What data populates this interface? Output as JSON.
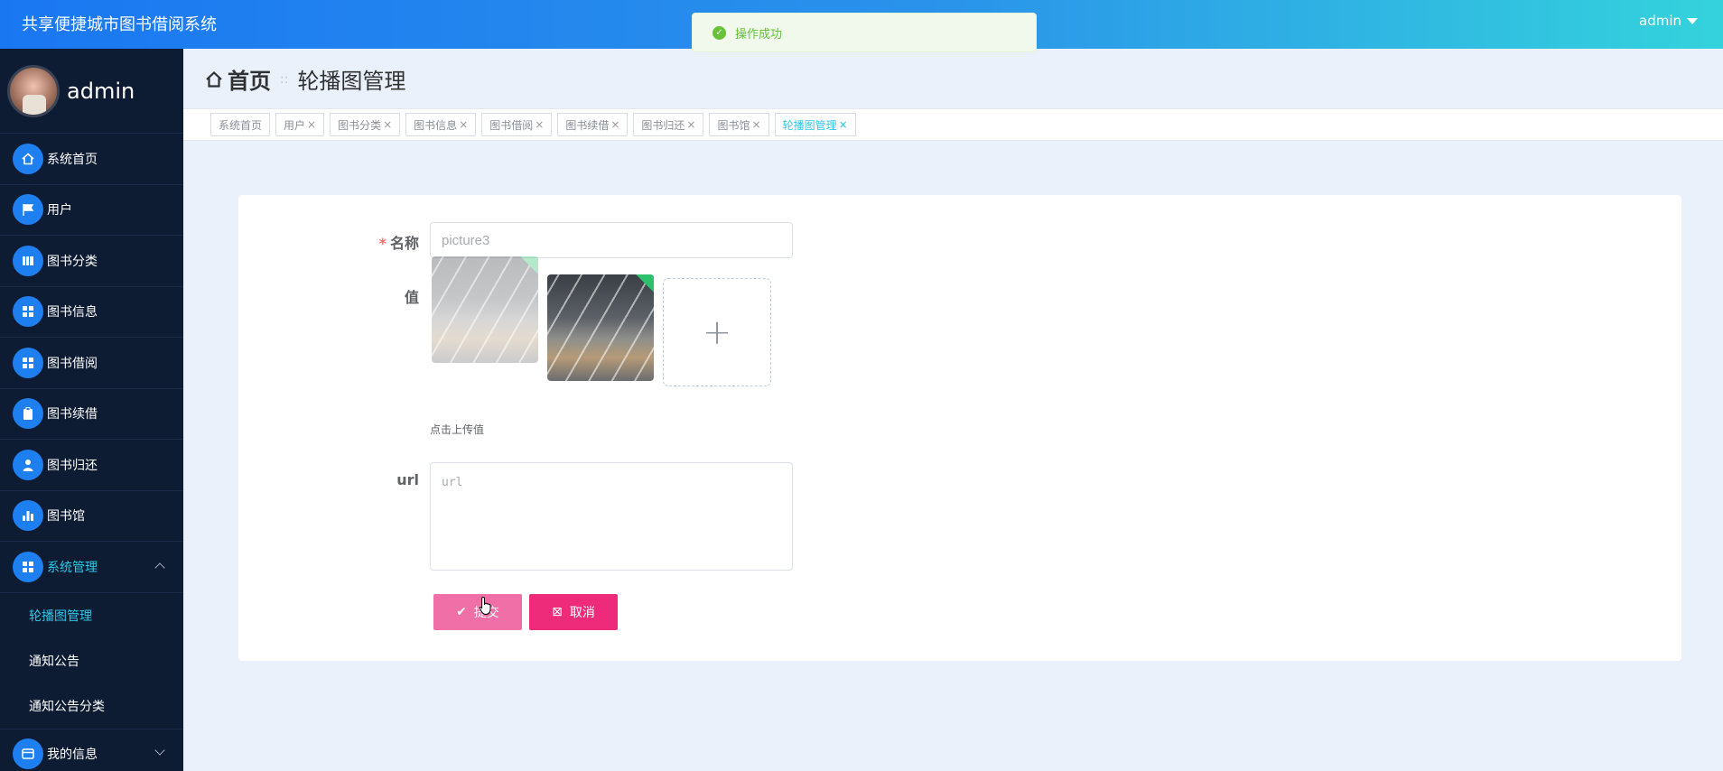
{
  "header": {
    "title": "共享便捷城市图书借阅系统",
    "user": "admin"
  },
  "toast": {
    "message": "操作成功",
    "accent": "#67c23a"
  },
  "sidebar": {
    "username": "admin",
    "items": [
      {
        "label": "系统首页",
        "icon": "home-icon"
      },
      {
        "label": "用户",
        "icon": "flag-icon"
      },
      {
        "label": "图书分类",
        "icon": "books-icon"
      },
      {
        "label": "图书信息",
        "icon": "grid-icon"
      },
      {
        "label": "图书借阅",
        "icon": "grid-icon"
      },
      {
        "label": "图书续借",
        "icon": "clipboard-icon"
      },
      {
        "label": "图书归还",
        "icon": "person-icon"
      },
      {
        "label": "图书馆",
        "icon": "bar-chart-icon"
      },
      {
        "label": "系统管理",
        "icon": "grid-icon"
      }
    ],
    "submenu": [
      {
        "label": "轮播图管理"
      },
      {
        "label": "通知公告"
      },
      {
        "label": "通知公告分类"
      }
    ],
    "my_info": "我的信息"
  },
  "breadcrumb": {
    "home": "首页",
    "current": "轮播图管理"
  },
  "tags": [
    {
      "label": "系统首页",
      "closable": false
    },
    {
      "label": "用户",
      "closable": true
    },
    {
      "label": "图书分类",
      "closable": true
    },
    {
      "label": "图书信息",
      "closable": true
    },
    {
      "label": "图书借阅",
      "closable": true
    },
    {
      "label": "图书续借",
      "closable": true
    },
    {
      "label": "图书归还",
      "closable": true
    },
    {
      "label": "图书馆",
      "closable": true
    },
    {
      "label": "轮播图管理",
      "closable": true,
      "active": true
    }
  ],
  "form": {
    "name_label": "名称",
    "name_value": "picture3",
    "value_label": "值",
    "upload_hint": "点击上传值",
    "url_label": "url",
    "url_placeholder": "url",
    "submit_label": "提交",
    "cancel_label": "取消"
  }
}
